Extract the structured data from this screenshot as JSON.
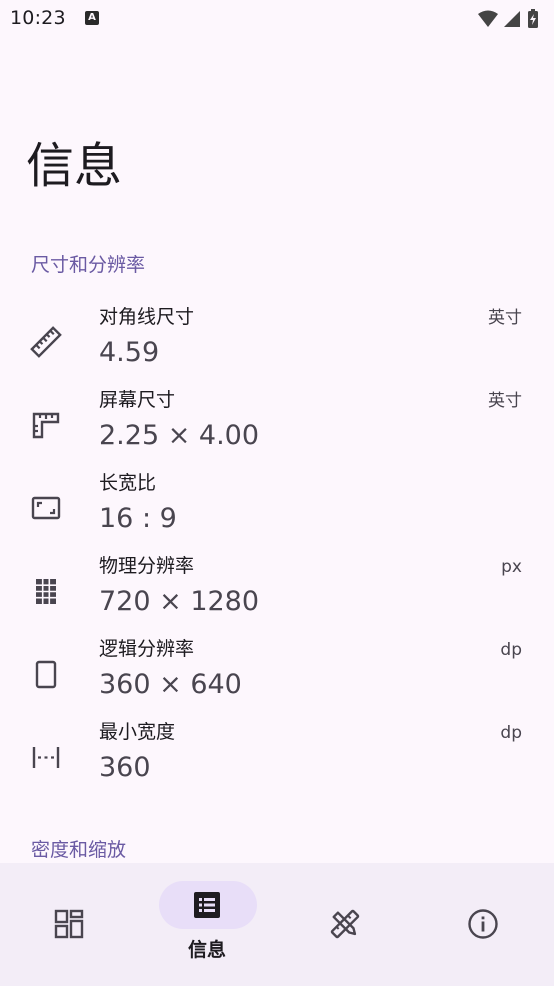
{
  "status_bar": {
    "time": "10:23",
    "notification_icon": "a-icon"
  },
  "page": {
    "title": "信息"
  },
  "sections": [
    {
      "header": "尺寸和分辨率",
      "items": [
        {
          "icon": "ruler-icon",
          "label": "对角线尺寸",
          "value": "4.59",
          "unit": "英寸"
        },
        {
          "icon": "screen-size-icon",
          "label": "屏幕尺寸",
          "value": "2.25 × 4.00",
          "unit": "英寸"
        },
        {
          "icon": "aspect-ratio-icon",
          "label": "长宽比",
          "value": "16 : 9",
          "unit": ""
        },
        {
          "icon": "grid-icon",
          "label": "物理分辨率",
          "value": "720 × 1280",
          "unit": "px"
        },
        {
          "icon": "phone-outline-icon",
          "label": "逻辑分辨率",
          "value": "360 × 640",
          "unit": "dp"
        },
        {
          "icon": "width-icon",
          "label": "最小宽度",
          "value": "360",
          "unit": "dp"
        }
      ]
    },
    {
      "header": "密度和缩放",
      "items": []
    }
  ],
  "bottom_nav": {
    "items": [
      {
        "icon": "dashboard-icon",
        "label": "",
        "active": false
      },
      {
        "icon": "list-icon",
        "label": "信息",
        "active": true
      },
      {
        "icon": "tools-icon",
        "label": "",
        "active": false
      },
      {
        "icon": "info-icon",
        "label": "",
        "active": false
      }
    ]
  },
  "colors": {
    "background": "#fdf7fd",
    "accent_text": "#6a5aa3",
    "nav_background": "#f3edf7",
    "nav_indicator": "#e8def8"
  }
}
